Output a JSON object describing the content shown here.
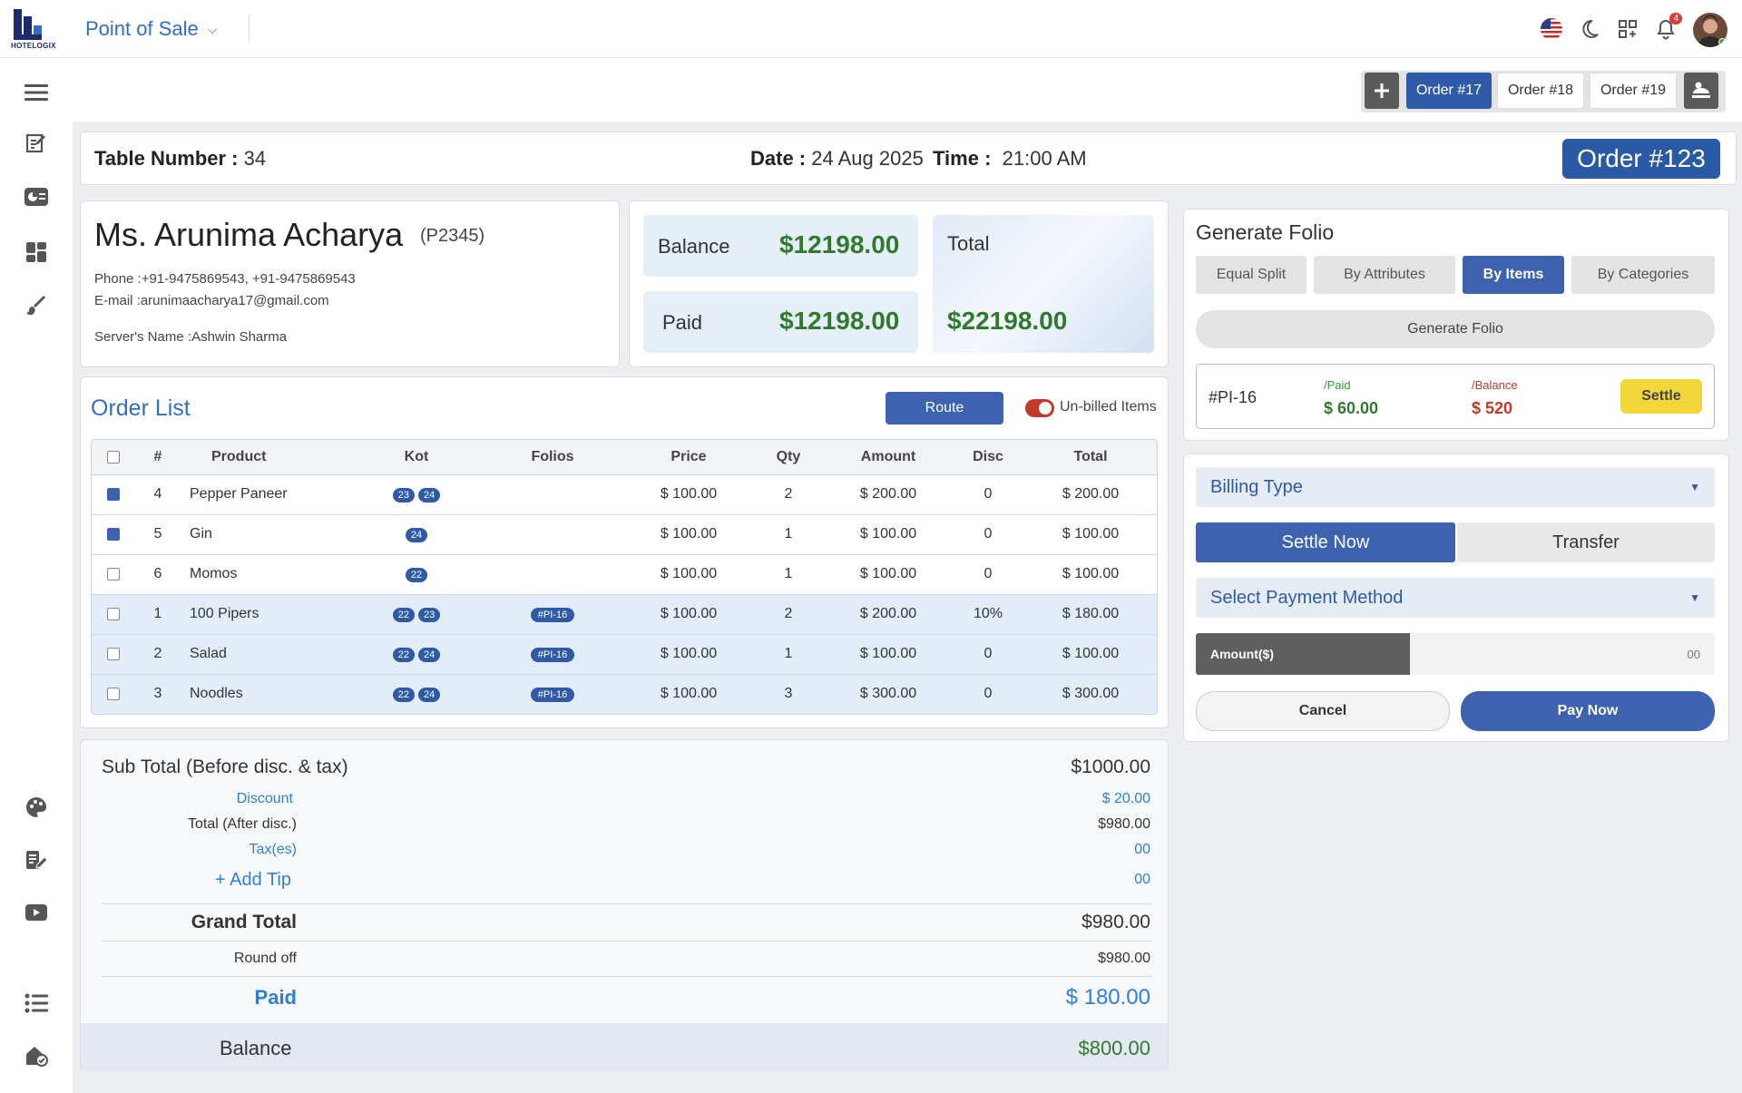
{
  "app": {
    "title": "Point of Sale",
    "logo_text": "HOTELOGIX",
    "notifications": "4"
  },
  "order_tabs": [
    {
      "label": "Order #17",
      "active": true
    },
    {
      "label": "Order #18",
      "active": false
    },
    {
      "label": "Order #19",
      "active": false
    }
  ],
  "header": {
    "table_label": "Table Number :",
    "table_value": "34",
    "date_label": "Date :",
    "date_value": "24 Aug 2025",
    "time_label": "Time :",
    "time_value": "21:00 AM",
    "order_label": "Order #123"
  },
  "guest": {
    "name": "Ms. Arunima Acharya",
    "code": "(P2345)",
    "phone_label": "Phone :",
    "phone": "+91-9475869543, +91-9475869543",
    "email_label": "E-mail :",
    "email": "arunimaacharya17@gmail.com",
    "server_label": "Server's Name :",
    "server": "Ashwin Sharma"
  },
  "totals": {
    "balance_label": "Balance",
    "balance_value": "$12198.00",
    "paid_label": "Paid",
    "paid_value": "$12198.00",
    "total_label": "Total",
    "total_value": "$22198.00"
  },
  "order_list": {
    "title": "Order List",
    "route_label": "Route",
    "unbilled_label": "Un-billed Items",
    "columns": [
      "#",
      "Product",
      "Kot",
      "Folios",
      "Price",
      "Qty",
      "Amount",
      "Disc",
      "Total"
    ],
    "rows": [
      {
        "num": "4",
        "product": "Pepper Paneer",
        "kots": [
          "23",
          "24"
        ],
        "folio": "",
        "price": "$ 100.00",
        "qty": "2",
        "amount": "$ 200.00",
        "disc": "0",
        "total": "$ 200.00",
        "checked": true,
        "billed": false
      },
      {
        "num": "5",
        "product": "Gin",
        "kots": [
          "24"
        ],
        "folio": "",
        "price": "$ 100.00",
        "qty": "1",
        "amount": "$ 100.00",
        "disc": "0",
        "total": "$ 100.00",
        "checked": true,
        "billed": false
      },
      {
        "num": "6",
        "product": "Momos",
        "kots": [
          "22"
        ],
        "folio": "",
        "price": "$ 100.00",
        "qty": "1",
        "amount": "$ 100.00",
        "disc": "0",
        "total": "$ 100.00",
        "checked": false,
        "billed": false
      },
      {
        "num": "1",
        "product": "100 Pipers",
        "kots": [
          "22",
          "23"
        ],
        "folio": "#PI-16",
        "price": "$ 100.00",
        "qty": "2",
        "amount": "$ 200.00",
        "disc": "10%",
        "total": "$ 180.00",
        "checked": false,
        "billed": true
      },
      {
        "num": "2",
        "product": "Salad",
        "kots": [
          "22",
          "24"
        ],
        "folio": "#PI-16",
        "price": "$ 100.00",
        "qty": "1",
        "amount": "$ 100.00",
        "disc": "0",
        "total": "$ 100.00",
        "checked": false,
        "billed": true
      },
      {
        "num": "3",
        "product": "Noodles",
        "kots": [
          "22",
          "24"
        ],
        "folio": "#PI-16",
        "price": "$ 100.00",
        "qty": "3",
        "amount": "$ 300.00",
        "disc": "0",
        "total": "$ 300.00",
        "checked": false,
        "billed": true
      }
    ]
  },
  "summary": {
    "subtotal_label": "Sub Total (Before disc. & tax)",
    "subtotal_value": "$1000.00",
    "discount_label": "Discount",
    "discount_value": "$ 20.00",
    "after_disc_label": "Total (After disc.)",
    "after_disc_value": "$980.00",
    "tax_label": "Tax(es)",
    "tax_value": "00",
    "tip_label": "+ Add Tip",
    "tip_value": "00",
    "grand_label": "Grand Total",
    "grand_value": "$980.00",
    "roundoff_label": "Round off",
    "roundoff_value": "$980.00",
    "paid_label": "Paid",
    "paid_value": "$ 180.00",
    "balance_label": "Balance",
    "balance_value": "$800.00"
  },
  "folio": {
    "title": "Generate Folio",
    "split_options": [
      "Equal Split",
      "By Attributes",
      "By Items",
      "By Categories"
    ],
    "active_split": "By Items",
    "generate_label": "Generate Folio",
    "folio_id": "#PI-16",
    "paid_label": "/Paid",
    "paid_value": "$ 60.00",
    "balance_label": "/Balance",
    "balance_value": "$ 520",
    "settle_label": "Settle"
  },
  "payment": {
    "billing_type_label": "Billing Type",
    "settle_now_label": "Settle Now",
    "transfer_label": "Transfer",
    "payment_method_label": "Select Payment Method",
    "amount_label": "Amount($)",
    "amount_placeholder": "00",
    "cancel_label": "Cancel",
    "pay_now_label": "Pay Now"
  },
  "colors": {
    "primary": "#3d62b0",
    "accent_blue": "#2f6fc9",
    "money_green": "#2f7a2f",
    "settle_yellow": "#f2d73b",
    "danger_red": "#c0392b"
  }
}
